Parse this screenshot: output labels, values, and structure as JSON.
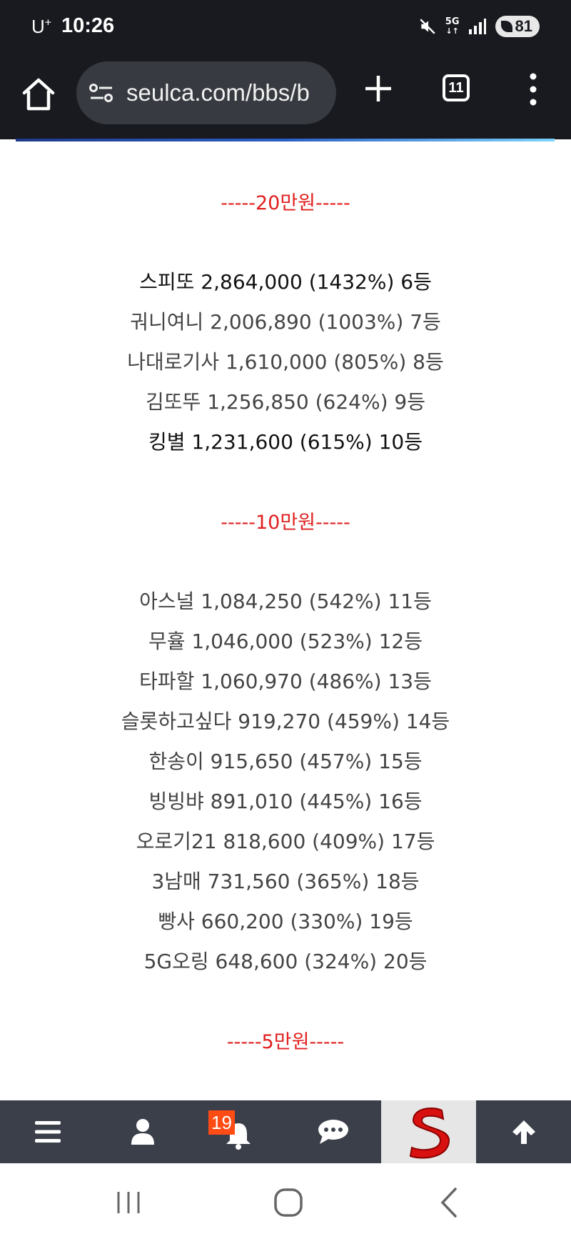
{
  "status_bar": {
    "carrier": "U",
    "carrier_sup": "+",
    "time": "10:26",
    "network": "5G",
    "battery": "81"
  },
  "browser": {
    "url": "seulca.com/bbs/b",
    "tab_count": "11"
  },
  "content": {
    "sections": [
      {
        "header": "-----20만원-----",
        "entries": [
          "스피또 2,864,000 (1432%) 6등",
          "궈니여니 2,006,890 (1003%) 7등",
          "나대로기사 1,610,000 (805%) 8등",
          "김또뚜 1,256,850 (624%) 9등",
          "킹별 1,231,600 (615%) 10등"
        ]
      },
      {
        "header": "-----10만원-----",
        "entries": [
          "아스널 1,084,250 (542%) 11등",
          "무휼 1,046,000 (523%) 12등",
          "타파할 1,060,970 (486%) 13등",
          "슬롯하고싶다 919,270 (459%) 14등",
          "한송이 915,650 (457%) 15등",
          "빙빙뱌 891,010 (445%) 16등",
          "오로기21 818,600 (409%) 17등",
          "3남매 731,560 (365%) 18등",
          "빵사 660,200 (330%) 19등",
          "5G오링 648,600 (324%) 20등"
        ]
      },
      {
        "header": "-----5만원-----",
        "entries": []
      }
    ]
  },
  "site_nav": {
    "notification_count": "19",
    "icons": [
      "menu-icon",
      "user-icon",
      "bell-icon",
      "chat-icon",
      "site-logo",
      "arrow-up-icon"
    ]
  },
  "colors": {
    "header_red": "#e02020",
    "nav_bg": "#3a3f4a",
    "badge": "#ff4b14",
    "chrome_bg": "#181a1f"
  }
}
